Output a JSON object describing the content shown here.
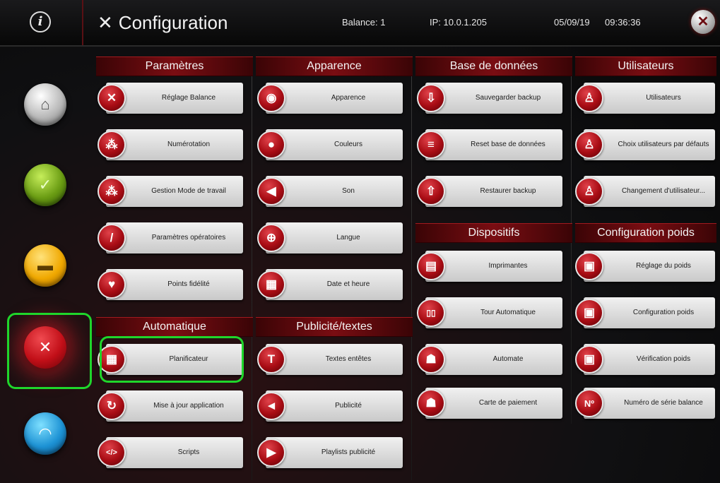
{
  "header": {
    "info_icon": "i",
    "title_icon": "tools-icon",
    "title": "Configuration",
    "balance": "Balance: 1",
    "ip": "IP: 10.0.1.205",
    "date": "05/09/19",
    "time": "09:36:36",
    "close_icon": "close-icon"
  },
  "nav": [
    {
      "name": "home",
      "icon": "home-icon",
      "glyph": "⌂"
    },
    {
      "name": "check",
      "icon": "check-icon",
      "glyph": "✓"
    },
    {
      "name": "display",
      "icon": "display-icon",
      "glyph": "▬"
    },
    {
      "name": "config",
      "icon": "tools-icon",
      "glyph": "✕",
      "selected": true
    },
    {
      "name": "wifi",
      "icon": "wifi-icon",
      "glyph": "◠"
    }
  ],
  "panels": {
    "parametres": {
      "title": "Paramètres",
      "items": [
        {
          "label": "Réglage Balance",
          "icon": "tools-icon",
          "glyph": "✕"
        },
        {
          "label": "Numérotation",
          "icon": "numbering-icon",
          "glyph": "⁂"
        },
        {
          "label": "Gestion Mode de travail",
          "icon": "network-icon",
          "glyph": "⁂"
        },
        {
          "label": "Paramètres opératoires",
          "icon": "knife-icon",
          "glyph": "/"
        },
        {
          "label": "Points fidélité",
          "icon": "heart-icon",
          "glyph": "♥"
        }
      ]
    },
    "automatique": {
      "title": "Automatique",
      "items": [
        {
          "label": "Planificateur",
          "icon": "calendar-icon",
          "glyph": "▦"
        },
        {
          "label": "Mise à jour application",
          "icon": "refresh-icon",
          "glyph": "↻"
        },
        {
          "label": "Scripts",
          "icon": "code-icon",
          "glyph": "</>"
        }
      ]
    },
    "apparence": {
      "title": "Apparence",
      "items": [
        {
          "label": "Apparence",
          "icon": "eye-icon",
          "glyph": "◉"
        },
        {
          "label": "Couleurs",
          "icon": "drop-icon",
          "glyph": "●"
        },
        {
          "label": "Son",
          "icon": "speaker-icon",
          "glyph": "◀"
        },
        {
          "label": "Langue",
          "icon": "globe-icon",
          "glyph": "⊕"
        },
        {
          "label": "Date et heure",
          "icon": "calendar-clock-icon",
          "glyph": "▦"
        }
      ]
    },
    "publicite": {
      "title": "Publicité/textes",
      "items": [
        {
          "label": "Textes entêtes",
          "icon": "text-icon",
          "glyph": "T"
        },
        {
          "label": "Publicité",
          "icon": "megaphone-icon",
          "glyph": "◄"
        },
        {
          "label": "Playlists publicité",
          "icon": "play-icon",
          "glyph": "▶"
        }
      ]
    },
    "base_donnees": {
      "title": "Base de données",
      "items": [
        {
          "label": "Sauvegarder backup",
          "icon": "download-icon",
          "glyph": "⇩"
        },
        {
          "label": "Reset base de données",
          "icon": "database-icon",
          "glyph": "≡"
        },
        {
          "label": "Restaurer backup",
          "icon": "upload-icon",
          "glyph": "⇧"
        }
      ]
    },
    "dispositifs": {
      "title": "Dispositifs",
      "items": [
        {
          "label": "Imprimantes",
          "icon": "printer-icon",
          "glyph": "▤"
        },
        {
          "label": "Tour Automatique",
          "icon": "tower-icon",
          "glyph": "▯▯"
        },
        {
          "label": "Automate",
          "icon": "automate-icon",
          "glyph": "☗"
        },
        {
          "label": "Carte de paiement",
          "icon": "payment-card-icon",
          "glyph": "☗"
        }
      ]
    },
    "utilisateurs": {
      "title": "Utilisateurs",
      "items": [
        {
          "label": "Utilisateurs",
          "icon": "user-icon",
          "glyph": "♙"
        },
        {
          "label": "Choix utilisateurs par défauts",
          "icon": "user-default-icon",
          "glyph": "♙"
        },
        {
          "label": "Changement d'utilisateur...",
          "icon": "user-switch-icon",
          "glyph": "♙"
        }
      ]
    },
    "config_poids": {
      "title": "Configuration poids",
      "items": [
        {
          "label": "Réglage du poids",
          "icon": "weight-icon",
          "glyph": "▣"
        },
        {
          "label": "Configuration poids",
          "icon": "weight-config-icon",
          "glyph": "▣"
        },
        {
          "label": "Vérification poids",
          "icon": "weight-check-icon",
          "glyph": "▣"
        },
        {
          "label": "Numéro de série balance",
          "icon": "serial-number-icon",
          "glyph": "Nº"
        }
      ]
    }
  }
}
